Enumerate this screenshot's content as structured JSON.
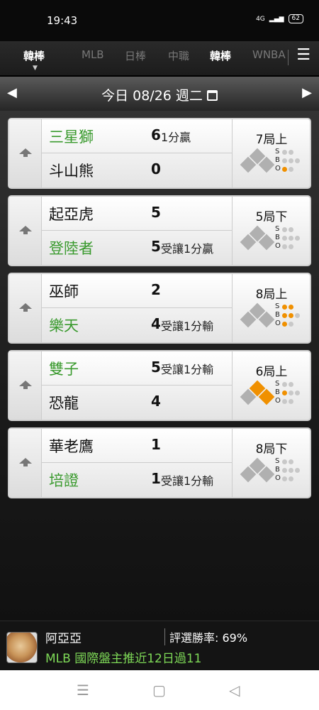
{
  "status": {
    "time": "19:43",
    "battery": "62",
    "network": "4G"
  },
  "tabs": [
    {
      "label": "韓棒",
      "active": true
    },
    {
      "label": "MLB",
      "active": false
    },
    {
      "label": "日棒",
      "active": false
    },
    {
      "label": "中職",
      "active": false
    },
    {
      "label": "韓棒",
      "active": false
    },
    {
      "label": "WNBA",
      "active": false
    }
  ],
  "date_bar": {
    "prev_icon": "◀",
    "next_icon": "▶",
    "date_text": "今日 08/26 週二"
  },
  "games": [
    {
      "top": {
        "name": "三星獅",
        "score": "6",
        "note": "1分贏",
        "fav": true
      },
      "bottom": {
        "name": "斗山熊",
        "score": "0",
        "note": "",
        "fav": false
      },
      "inning": "7局上",
      "bases": {
        "first": false,
        "second": false,
        "third": false
      },
      "count": {
        "s": 0,
        "b": 0,
        "o": 1
      }
    },
    {
      "top": {
        "name": "起亞虎",
        "score": "5",
        "note": "",
        "fav": false
      },
      "bottom": {
        "name": "登陸者",
        "score": "5",
        "note": "受讓1分贏",
        "fav": true
      },
      "inning": "5局下",
      "bases": {
        "first": false,
        "second": false,
        "third": false
      },
      "count": {
        "s": 0,
        "b": 0,
        "o": 0
      }
    },
    {
      "top": {
        "name": "巫師",
        "score": "2",
        "note": "",
        "fav": false
      },
      "bottom": {
        "name": "樂天",
        "score": "4",
        "note": "受讓1分輸",
        "fav": true
      },
      "inning": "8局上",
      "bases": {
        "first": false,
        "second": false,
        "third": false
      },
      "count": {
        "s": 2,
        "b": 2,
        "o": 1
      }
    },
    {
      "top": {
        "name": "雙子",
        "score": "5",
        "note": "受讓1分輸",
        "fav": true
      },
      "bottom": {
        "name": "恐龍",
        "score": "4",
        "note": "",
        "fav": false
      },
      "inning": "6局上",
      "bases": {
        "first": true,
        "second": true,
        "third": false
      },
      "count": {
        "s": 0,
        "b": 1,
        "o": 0
      }
    },
    {
      "top": {
        "name": "華老鷹",
        "score": "1",
        "note": "",
        "fav": false
      },
      "bottom": {
        "name": "培證",
        "score": "1",
        "note": "受讓1分輸",
        "fav": true
      },
      "inning": "8局下",
      "bases": {
        "first": false,
        "second": false,
        "third": false
      },
      "count": {
        "s": 0,
        "b": 0,
        "o": 0
      }
    }
  ],
  "sbo_labels": {
    "s": "S",
    "b": "B",
    "o": "O"
  },
  "promo": {
    "user_name": "阿亞亞",
    "win_rate": "評選勝率: 69%",
    "text": "MLB 國際盤主推近12日過11"
  },
  "nav": {
    "menu": "☰",
    "home": "▢",
    "back": "◁"
  },
  "colors": {
    "favorite": "#3a9a2e",
    "base_on": "#f09000",
    "promo_text": "#7ed957"
  }
}
